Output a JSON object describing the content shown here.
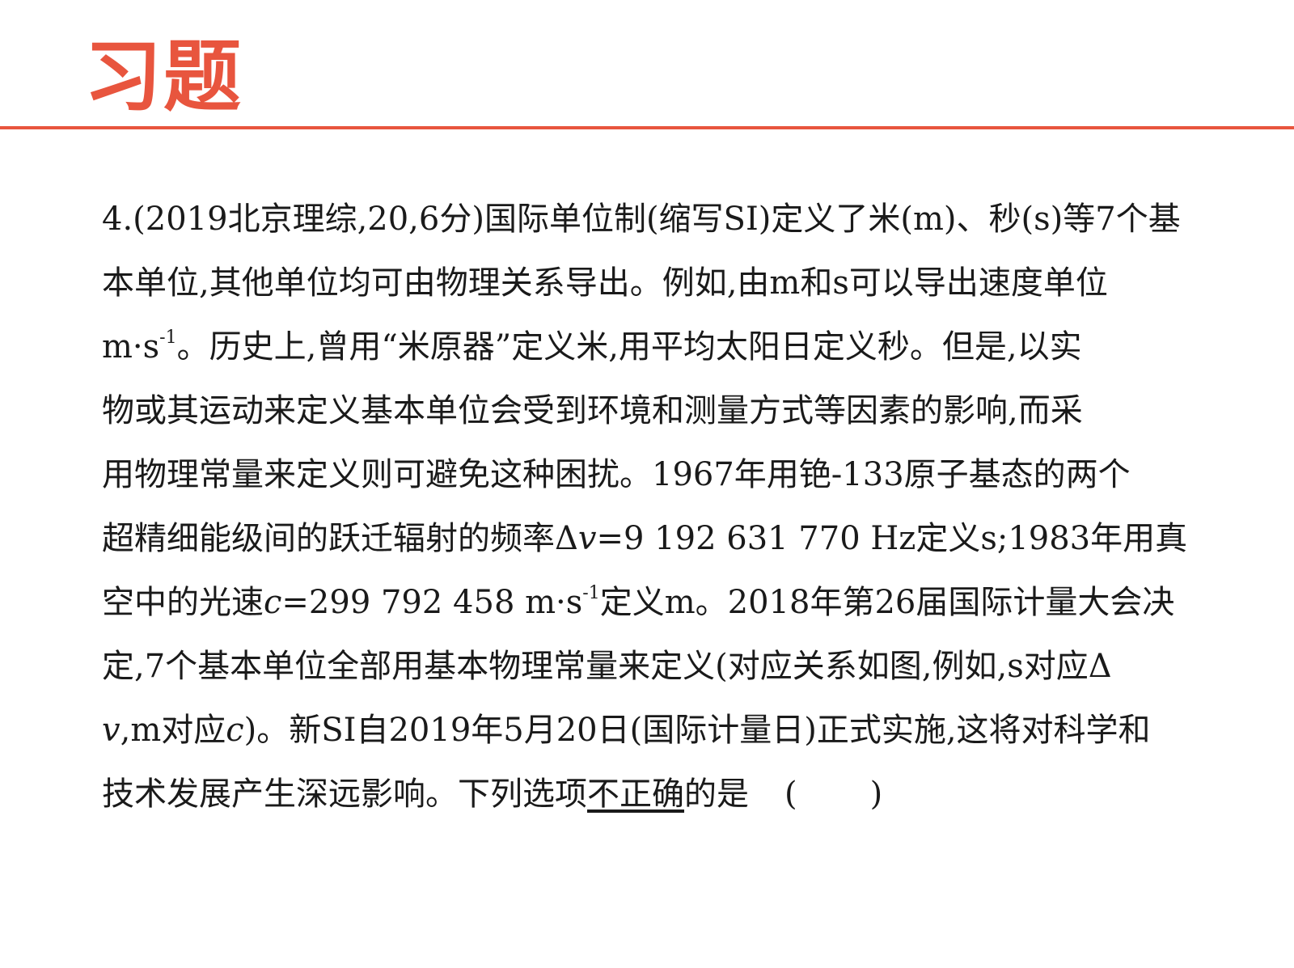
{
  "slide": {
    "title": "习题",
    "accent_color": "#e8553e"
  },
  "question": {
    "l1": "4.(2019北京理综,20,6分)国际单位制(缩写SI)定义了米(m)、秒(s)等7个基",
    "l2": "本单位,其他单位均可由物理关系导出。例如,由m和s可以导出速度单位",
    "l3_a": "m·s",
    "l3_sup": "-1",
    "l3_b": "。历史上,曾用“米原器”定义米,用平均太阳日定义秒。但是,以实",
    "l4": "物或其运动来定义基本单位会受到环境和测量方式等因素的影响,而采",
    "l5": "用物理常量来定义则可避免这种困扰。1967年用铯-133原子基态的两个",
    "l6_a": "超精细能级间的跃迁辐射的频率Δ",
    "l6_v": "v",
    "l6_b": "=9 192 631 770 Hz定义s;1983年用真",
    "l7_a": "空中的光速",
    "l7_c": "c",
    "l7_b": "=299 792 458 m·s",
    "l7_sup": "-1",
    "l7_d": "定义m。2018年第26届国际计量大会决",
    "l8": "定,7个基本单位全部用基本物理常量来定义(对应关系如图,例如,s对应Δ",
    "l9_v": "v",
    "l9_a": ",m对应",
    "l9_c": "c",
    "l9_b": ")。新SI自2019年5月20日(国际计量日)正式实施,这将对科学和",
    "l10_a": "技术发展产生深远影响。下列选项",
    "l10_u": "不正确",
    "l10_b": "的是",
    "bracket_open": "(",
    "bracket_close": ")"
  }
}
